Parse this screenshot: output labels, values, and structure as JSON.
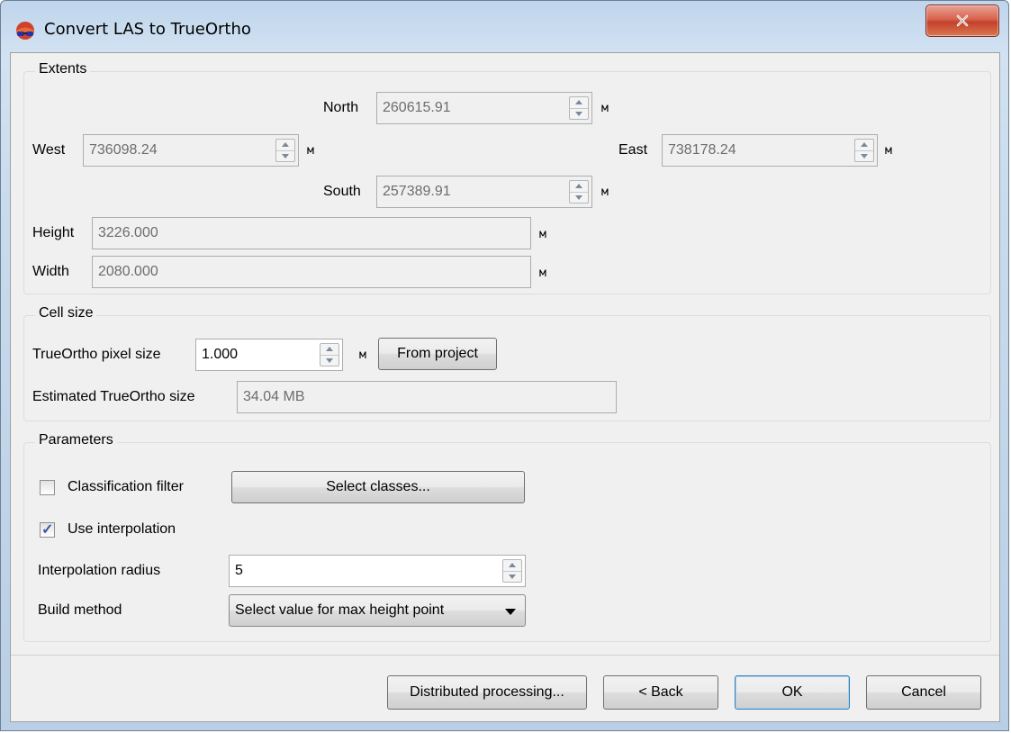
{
  "window": {
    "title": "Convert LAS to TrueOrtho",
    "app_icon": "red-blue-3d-glasses-icon",
    "close_icon": "close-x-icon"
  },
  "extents": {
    "title": "Extents",
    "north": {
      "label": "North",
      "value": "260615.91",
      "unit": "м"
    },
    "west": {
      "label": "West",
      "value": "736098.24",
      "unit": "м"
    },
    "east": {
      "label": "East",
      "value": "738178.24",
      "unit": "м"
    },
    "south": {
      "label": "South",
      "value": "257389.91",
      "unit": "м"
    },
    "height": {
      "label": "Height",
      "value": "3226.000",
      "unit": "м"
    },
    "width": {
      "label": "Width",
      "value": "2080.000",
      "unit": "м"
    }
  },
  "cell_size": {
    "title": "Cell size",
    "pixel_size": {
      "label": "TrueOrtho pixel size",
      "value": "1.000",
      "unit": "м"
    },
    "from_project_label": "From project",
    "estimated": {
      "label": "Estimated TrueOrtho size",
      "value": "34.04 MB"
    }
  },
  "parameters": {
    "title": "Parameters",
    "classification_filter": {
      "label": "Classification filter",
      "checked": false
    },
    "select_classes_label": "Select classes...",
    "use_interpolation": {
      "label": "Use interpolation",
      "checked": true
    },
    "interpolation_radius": {
      "label": "Interpolation radius",
      "value": "5"
    },
    "build_method": {
      "label": "Build method",
      "value": "Select value for max height point"
    }
  },
  "footer": {
    "distributed_label": "Distributed processing...",
    "back_label": "< Back",
    "ok_label": "OK",
    "cancel_label": "Cancel"
  },
  "colors": {
    "title_gradient": "#c9dbee",
    "close_button": "#c3412b",
    "default_button_border": "#3c7fb1"
  }
}
